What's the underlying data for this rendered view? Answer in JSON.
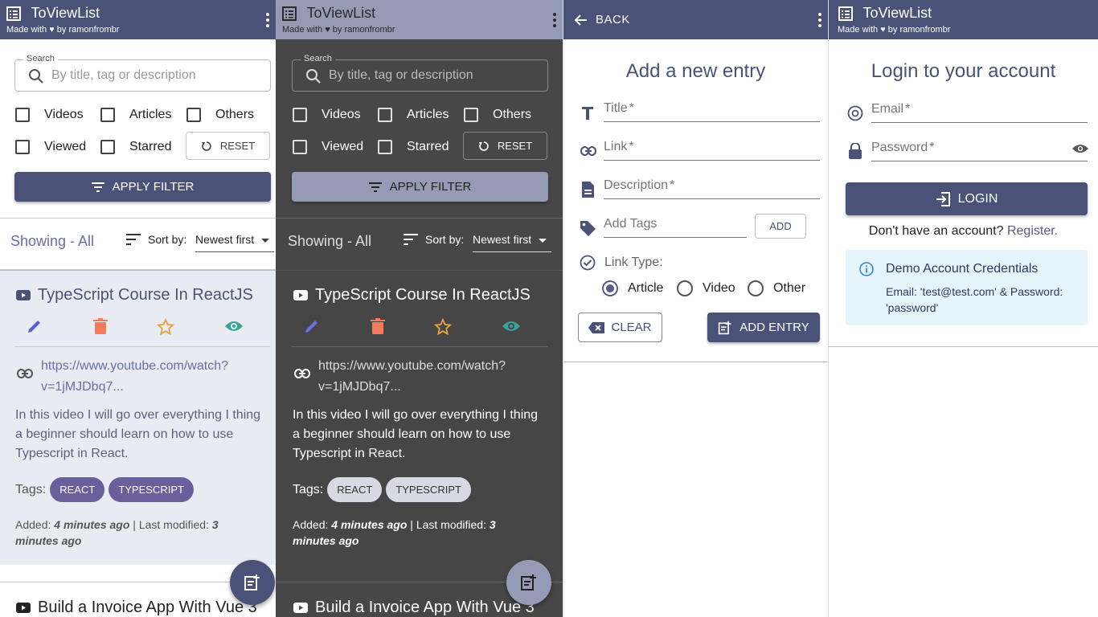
{
  "app": {
    "title": "ToViewList",
    "subtitle_prefix": "Made with",
    "subtitle_suffix": "by ramonfrombr"
  },
  "filters": {
    "search_label": "Search",
    "search_placeholder": "By title, tag or description",
    "videos": "Videos",
    "articles": "Articles",
    "others": "Others",
    "viewed": "Viewed",
    "starred": "Starred",
    "reset": "RESET",
    "apply": "APPLY FILTER"
  },
  "list": {
    "showing": "Showing - All",
    "sort_label": "Sort by:",
    "sort_value": "Newest first"
  },
  "entry1": {
    "title": "TypeScript Course In ReactJS",
    "link": "https://www.youtube.com/watch?v=1jMJDbq7...",
    "description": "In this video I will go over everything I thing a beginner should learn on how to use Typescript in React.",
    "tags_label": "Tags:",
    "tags": [
      "REACT",
      "TYPESCRIPT"
    ],
    "added_label": "Added:",
    "added_value": "4 minutes ago",
    "modified_label": "| Last modified:",
    "modified_value": "3 minutes ago"
  },
  "entry2": {
    "title": "Build a Invoice App With Vue 3"
  },
  "add_form": {
    "back": "BACK",
    "heading": "Add a new entry",
    "title_label": "Title",
    "link_label": "Link",
    "description_label": "Description",
    "tags_placeholder": "Add Tags",
    "add_button": "ADD",
    "link_type_label": "Link Type:",
    "types": [
      "Article",
      "Video",
      "Other"
    ],
    "selected_type": "Article",
    "clear_button": "CLEAR",
    "add_entry_button": "ADD ENTRY",
    "required_mark": "*"
  },
  "login": {
    "heading": "Login to your account",
    "email_label": "Email",
    "password_label": "Password",
    "login_button": "LOGIN",
    "no_account": "Don't have an account?",
    "register": "Register.",
    "demo_title": "Demo Account Credentials",
    "demo_body": "Email: 'test@test.com' & Password: 'password'"
  },
  "colors": {
    "primary": "#4a5377",
    "primary_light": "#969bb5",
    "dark_bg": "#474747",
    "chip": "#6a5f9a",
    "info_bg": "#e5f3fb",
    "delete": "#f27a5d",
    "star": "#e8a33d",
    "view": "#3aa39a",
    "edit": "#5a5fcf"
  }
}
